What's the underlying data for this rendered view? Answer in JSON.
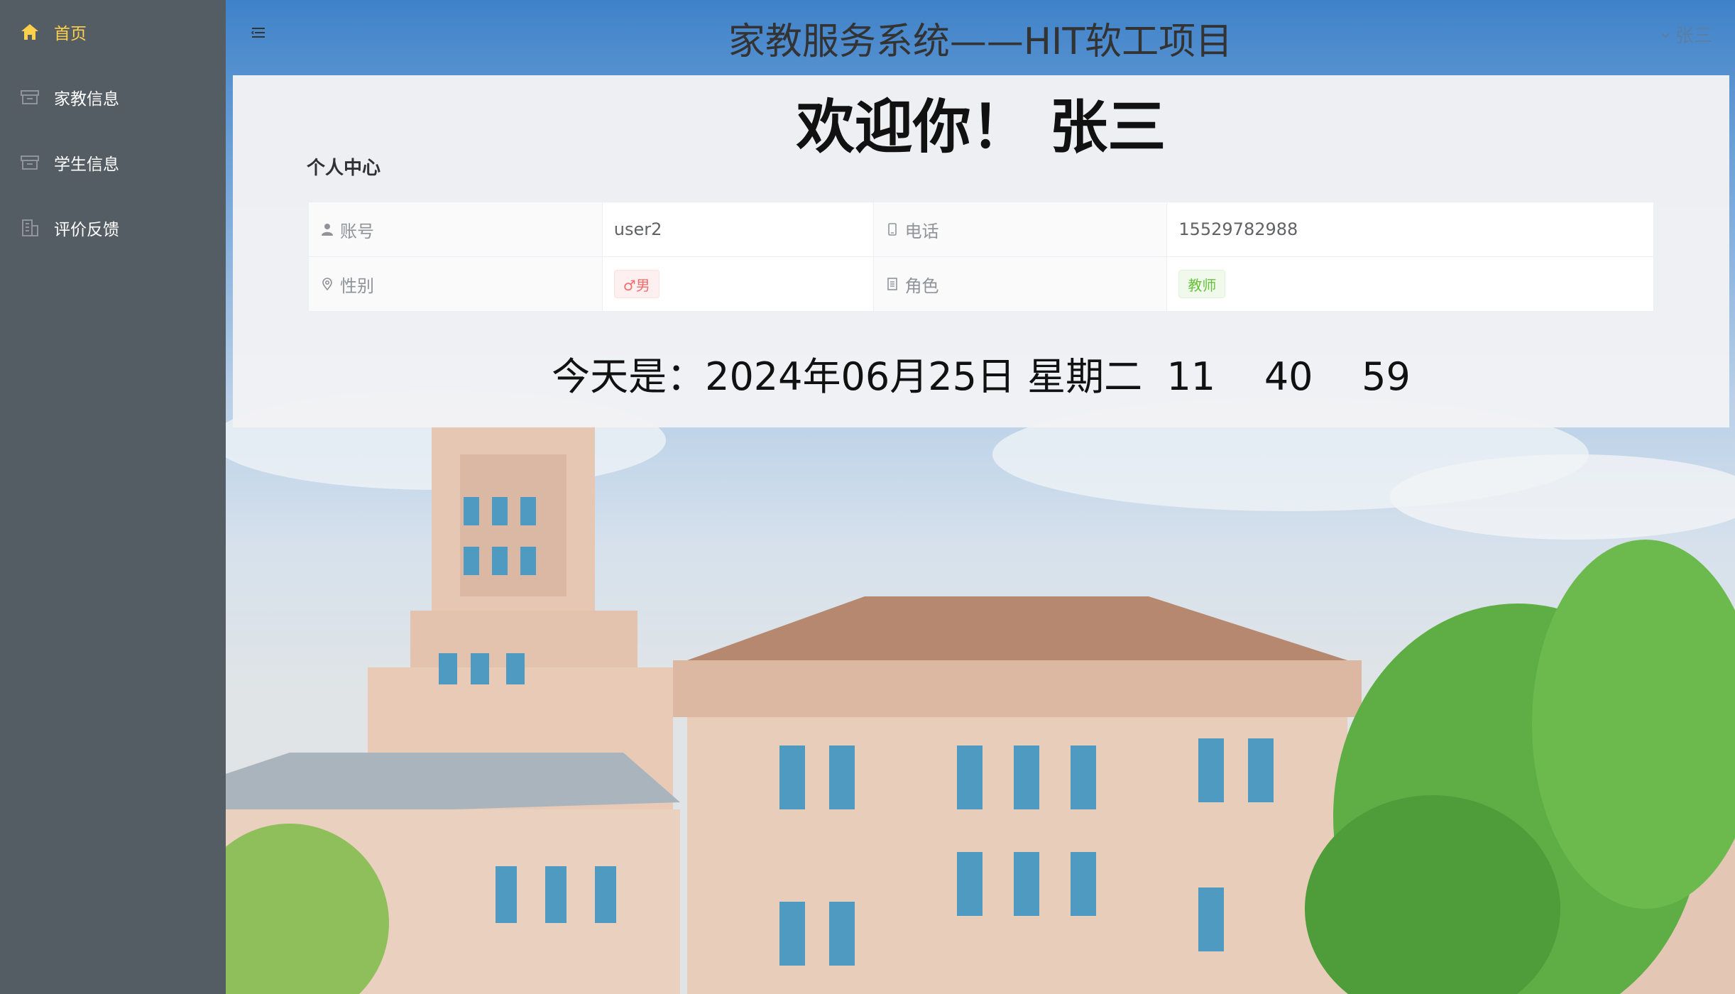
{
  "sidebar": {
    "items": [
      {
        "label": "首页",
        "icon": "home-icon",
        "active": true
      },
      {
        "label": "家教信息",
        "icon": "box-icon",
        "active": false
      },
      {
        "label": "学生信息",
        "icon": "box-icon",
        "active": false
      },
      {
        "label": "评价反馈",
        "icon": "office-building-icon",
        "active": false
      }
    ]
  },
  "header": {
    "title": "家教服务系统——HIT软工项目",
    "user_name": "张三"
  },
  "main": {
    "welcome": "欢迎你！ 张三",
    "section_title": "个人中心",
    "profile": {
      "account_label": "账号",
      "account_value": "user2",
      "phone_label": "电话",
      "phone_value": "15529782988",
      "gender_label": "性别",
      "gender_value": "♂男",
      "role_label": "角色",
      "role_value": "教师"
    },
    "date_line": "今天是：2024年06月25日 星期二  11    40    59"
  },
  "colors": {
    "sidebar_bg": "#545c64",
    "active_menu": "#ffd04b",
    "tag_danger": "#f56c6c",
    "tag_success": "#67c23a"
  }
}
